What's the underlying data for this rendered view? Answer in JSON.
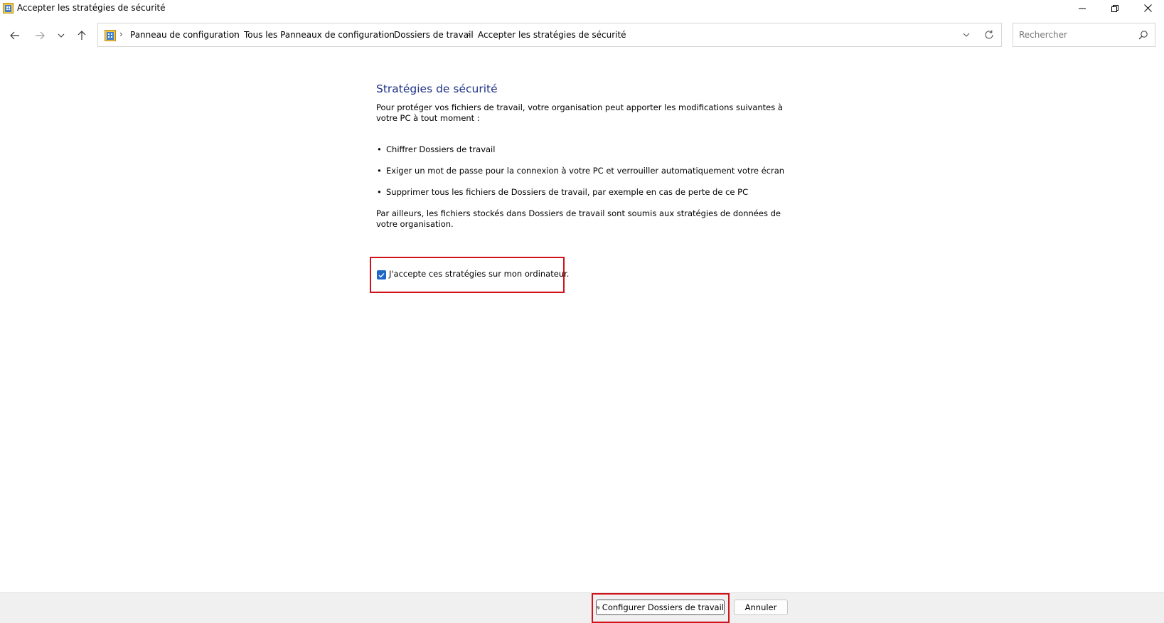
{
  "window": {
    "title": "Accepter les stratégies de sécurité",
    "icon": "control-panel-icon"
  },
  "nav": {
    "breadcrumbs": [
      "Panneau de configuration",
      "Tous les Panneaux de configuration",
      "Dossiers de travail",
      "Accepter les stratégies de sécurité"
    ],
    "search_placeholder": "Rechercher"
  },
  "content": {
    "heading": "Stratégies de sécurité",
    "intro": "Pour protéger vos fichiers de travail, votre organisation peut apporter les modifications suivantes à votre PC à tout moment :",
    "bullets": [
      "Chiffrer Dossiers de travail",
      "Exiger un mot de passe pour la connexion à votre PC et verrouiller automatiquement votre écran",
      "Supprimer tous les fichiers de Dossiers de travail, par exemple en cas de perte de ce PC"
    ],
    "outro": "Par ailleurs, les fichiers stockés dans Dossiers de travail sont soumis aux stratégies de données de votre organisation.",
    "accept_label": "J'accepte ces stratégies sur mon ordinateur.",
    "accept_checked": true
  },
  "footer": {
    "configure_label": "Configurer Dossiers de travail",
    "cancel_label": "Annuler"
  },
  "colors": {
    "heading": "#1e3287",
    "checkbox": "#1f66c9",
    "highlight": "#d0121b"
  }
}
